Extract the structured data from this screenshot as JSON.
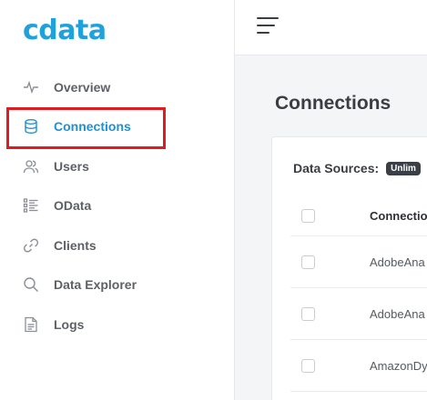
{
  "brand": {
    "logo_text": "cdata",
    "color": "#1fa2db"
  },
  "sidebar": {
    "items": [
      {
        "label": "Overview",
        "icon": "activity-icon"
      },
      {
        "label": "Connections",
        "icon": "database-icon",
        "active": true
      },
      {
        "label": "Users",
        "icon": "users-icon"
      },
      {
        "label": "OData",
        "icon": "odata-icon"
      },
      {
        "label": "Clients",
        "icon": "link-icon"
      },
      {
        "label": "Data Explorer",
        "icon": "search-icon"
      },
      {
        "label": "Logs",
        "icon": "document-icon"
      }
    ],
    "active_color": "#1e90d6",
    "highlight_color": "#e01b22"
  },
  "topbar": {
    "menu_icon": "hamburger-icon"
  },
  "main": {
    "title": "Connections",
    "data_sources_label": "Data Sources:",
    "badge": "Unlim",
    "table": {
      "columns": [
        "Connectio"
      ],
      "rows": [
        {
          "name": "AdobeAna"
        },
        {
          "name": "AdobeAna"
        },
        {
          "name": "AmazonDy"
        }
      ]
    }
  }
}
